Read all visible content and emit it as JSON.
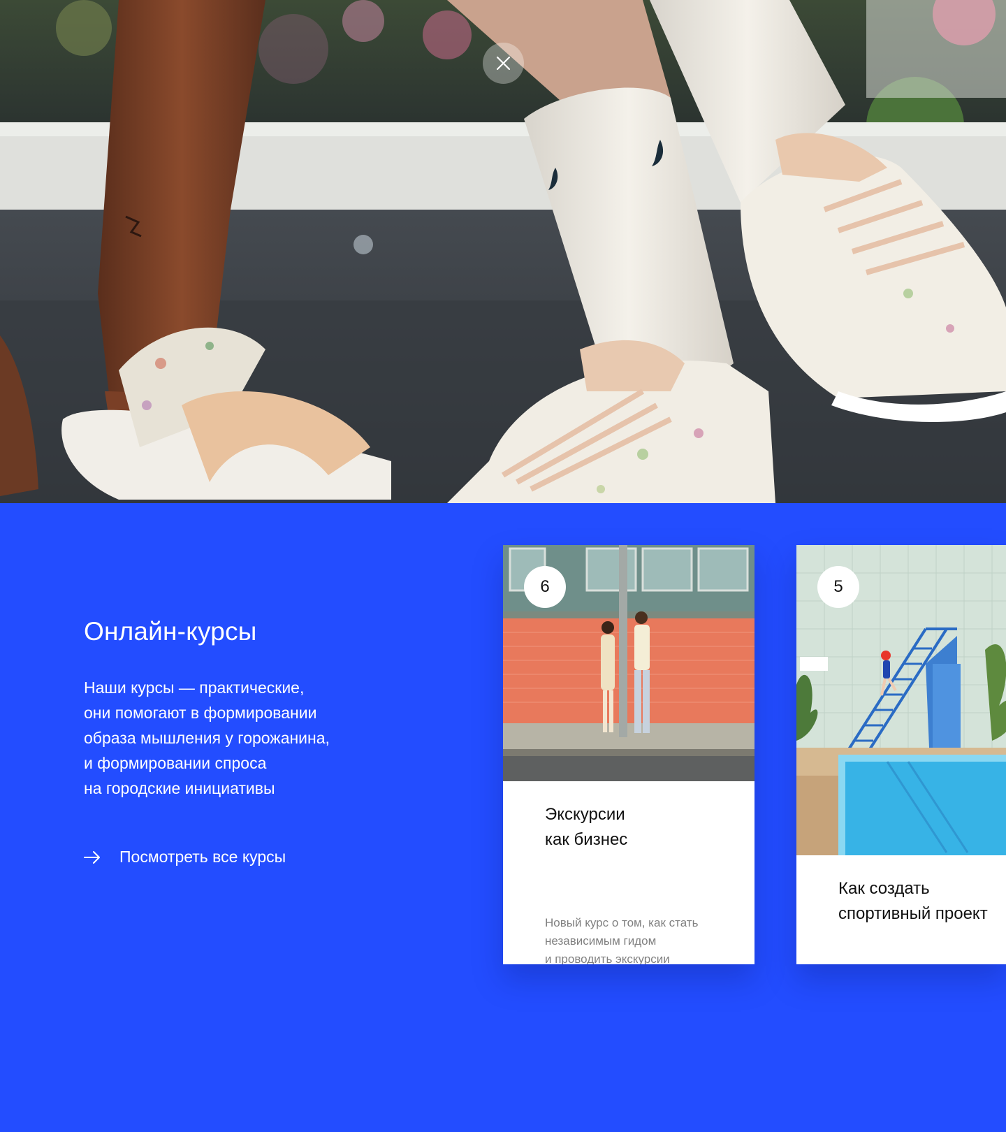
{
  "hero": {
    "image": "photo-feet-in-floral-sneakers-and-slides",
    "close_icon": "close-icon"
  },
  "courses": {
    "title": "Онлайн-курсы",
    "description_lines": [
      "Наши курсы — практические,",
      "они помогают в формировании",
      "образа мышления у горожанина,",
      "и формировании спроса",
      "на городские инициативы"
    ],
    "all_link": "Посмотреть все курсы",
    "cards": [
      {
        "number": "6",
        "title_lines": [
          "Экскурсии",
          "как бизнес"
        ],
        "desc_lines": [
          "Новый курс о том, как стать",
          "независимым гидом",
          "и проводить экскурсии"
        ]
      },
      {
        "number": "5",
        "title_lines": [
          "Как создать",
          "спортивный проект"
        ],
        "desc_lines": []
      }
    ]
  },
  "colors": {
    "accent": "#234dff",
    "card_bg": "#ffffff",
    "desc_gray": "#808080"
  }
}
